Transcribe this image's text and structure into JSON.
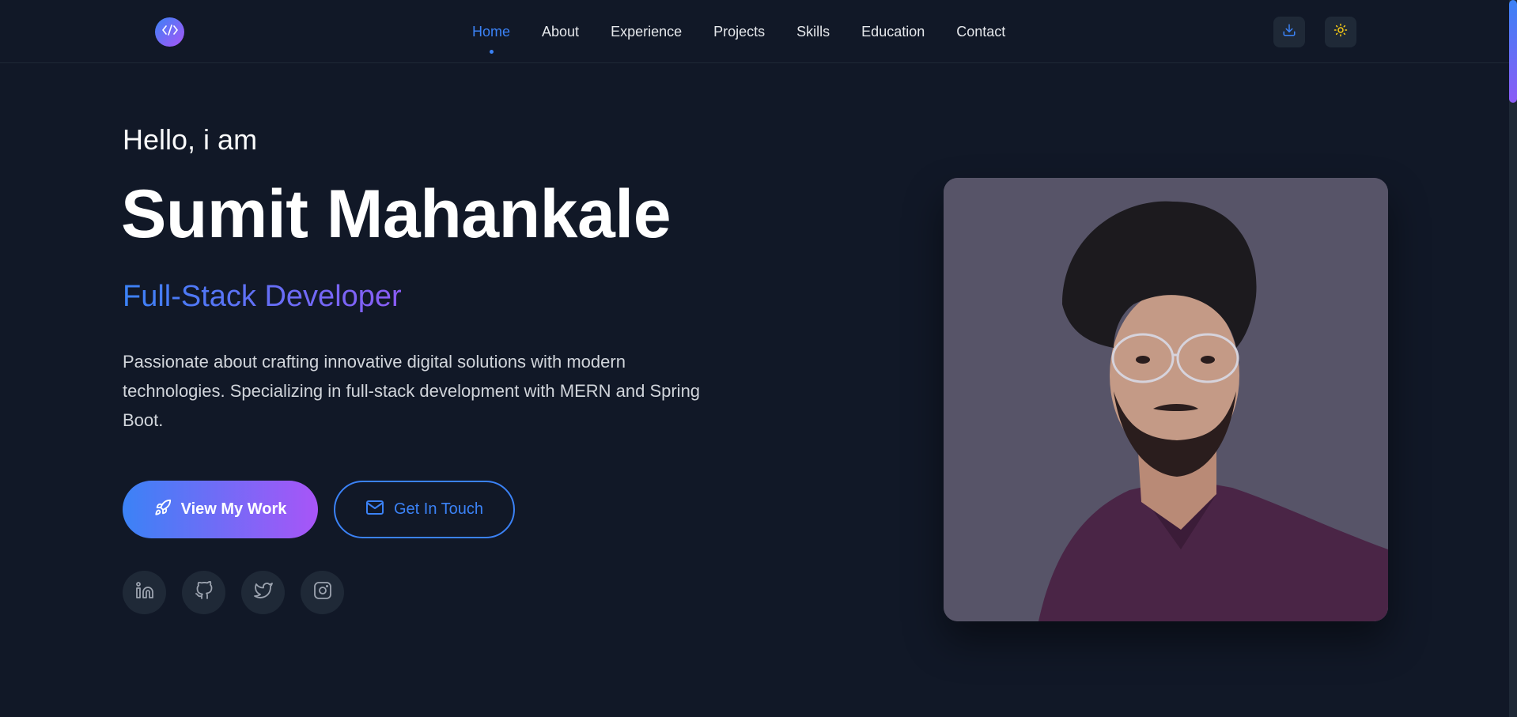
{
  "nav": {
    "logo_icon": "code-icon",
    "links": [
      {
        "label": "Home",
        "active": true
      },
      {
        "label": "About"
      },
      {
        "label": "Experience"
      },
      {
        "label": "Projects"
      },
      {
        "label": "Skills"
      },
      {
        "label": "Education"
      },
      {
        "label": "Contact"
      }
    ],
    "download_icon": "download-icon",
    "theme_icon": "sun-icon"
  },
  "hero": {
    "greeting": "Hello, i am",
    "name": "Sumit Mahankale",
    "role": "Full-Stack Developer",
    "description": "Passionate about crafting innovative digital solutions with modern technologies. Specializing in full-stack development with MERN and Spring Boot.",
    "primary_button": {
      "label": "View My Work",
      "icon": "rocket-icon"
    },
    "secondary_button": {
      "label": "Get In Touch",
      "icon": "mail-icon"
    },
    "socials": [
      "linkedin-icon",
      "github-icon",
      "twitter-icon",
      "instagram-icon"
    ]
  },
  "colors": {
    "background": "#111827",
    "accent": "#3b82f6",
    "accent_secondary": "#a855f7",
    "surface": "#1f2937"
  }
}
